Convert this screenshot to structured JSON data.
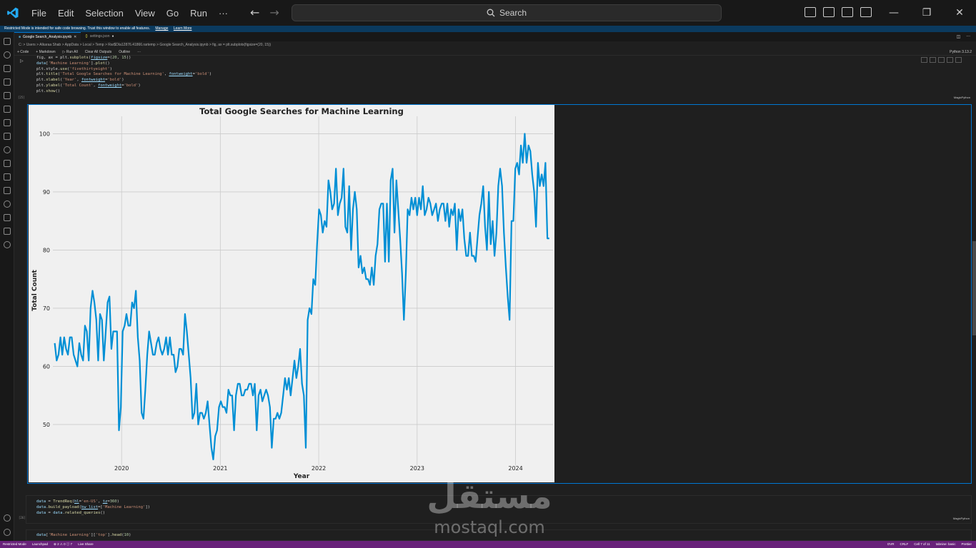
{
  "menu": [
    "File",
    "Edit",
    "Selection",
    "View",
    "Go",
    "Run",
    "···"
  ],
  "search_label": "Search",
  "restricted": {
    "text": "Restricted Mode is intended for safe code browsing. Trust this window to enable all features.",
    "manage": "Manage",
    "learn_more": "Learn More"
  },
  "tabs": [
    {
      "label": "Google Search_Analysis.ipynb",
      "active": true
    },
    {
      "label": "settings.json",
      "active": false
    }
  ],
  "breadcrumb": "C: > Users > Alkaraa Shab > AppData > Local > Temp > Rar$DIa12876.41866.rartemp > Google Search_Analysis.ipynb > fig, ax = plt.subplots(figsize=(20, 15))",
  "toolbar": {
    "code": "+ Code",
    "markdown": "+ Markdown",
    "run_all": "Run All",
    "clear_outputs": "Clear All Outputs",
    "outline": "Outline",
    "more": "···"
  },
  "kernel": "Python 3.13.2",
  "cell1": {
    "exec_count": "[25]",
    "lang": "MagicPython",
    "lines": [
      "fig, ax = plt.subplots(figsize=(20, 15))",
      "data['Machine Learning'].plot()",
      "plt.style.use('fivethirtyeight')",
      "plt.title('Total Google Searches for Machine Learning', fontweight='bold')",
      "plt.xlabel('Year', fontweight='bold')",
      "plt.ylabel('Total Count', fontweight='bold')",
      "plt.show()"
    ]
  },
  "cell2": {
    "exec_count": "[26]",
    "lang": "MagicPython",
    "lines": [
      "data = TrendReq(hl='en-US', tz=360)",
      "data.build_payload(kw_list=['Machine Learning'])",
      "data = data.related_queries()"
    ]
  },
  "cell3": {
    "lines": [
      "data['Machine Learning']['top'].head(10)"
    ]
  },
  "statusbar": {
    "left": [
      "Restricted Mode",
      "Launchpad",
      "⊗ 2 ⚠ 0 ⓘ 7",
      "Live Share"
    ],
    "right": [
      "OVR",
      "CRLF",
      "Cell 7 of 11",
      "tabnine: basic",
      "Prettier"
    ]
  },
  "watermark": {
    "ar": "مستقل",
    "en": "mostaql.com"
  },
  "colors": {
    "line": "#008fd5",
    "accent": "#0078d4",
    "status": "#68217a"
  },
  "chart_data": {
    "type": "line",
    "title": "Total Google Searches for Machine Learning",
    "xlabel": "Year",
    "ylabel": "Total Count",
    "x_ticks": [
      "2020",
      "2021",
      "2022",
      "2023",
      "2024"
    ],
    "y_ticks": [
      50,
      60,
      70,
      80,
      90,
      100
    ],
    "xlim": [
      "2019-04-21",
      "2024-05-19"
    ],
    "ylim": [
      43,
      103
    ],
    "grid": true,
    "series": [
      {
        "start": "2019-04-28",
        "interval_days": 7,
        "values": [
          64,
          61,
          62,
          65,
          62,
          65,
          63,
          62,
          65,
          65,
          62,
          61,
          60,
          64,
          62,
          61,
          67,
          66,
          61,
          70,
          73,
          71,
          68,
          61,
          69,
          68,
          61,
          66,
          71,
          72,
          63,
          66,
          66,
          66,
          49,
          53,
          66,
          67,
          69,
          67,
          67,
          71,
          70,
          73,
          65,
          61,
          52,
          51,
          56,
          62,
          66,
          64,
          62,
          62,
          64,
          65,
          63,
          62,
          63,
          65,
          62,
          65,
          62,
          62,
          59,
          60,
          63,
          63,
          62,
          69,
          66,
          62,
          58,
          51,
          52,
          57,
          50,
          52,
          52,
          51,
          52,
          54,
          50,
          46,
          44,
          48,
          49,
          53,
          54,
          53,
          53,
          52,
          56,
          55,
          55,
          49,
          55,
          57,
          57,
          55,
          55,
          56,
          56,
          57,
          57,
          55,
          57,
          49,
          55,
          56,
          54,
          55,
          56,
          55,
          53,
          46,
          51,
          51,
          52,
          51,
          52,
          55,
          58,
          56,
          58,
          55,
          58,
          61,
          58,
          60,
          63,
          57,
          55,
          46,
          68,
          70,
          69,
          75,
          74,
          81,
          87,
          86,
          83,
          85,
          84,
          92,
          90,
          87,
          88,
          94,
          86,
          88,
          89,
          94,
          84,
          83,
          91,
          80,
          87,
          90,
          87,
          77,
          79,
          76,
          77,
          75,
          75,
          74,
          77,
          74,
          79,
          81,
          87,
          88,
          88,
          78,
          88,
          78,
          92,
          94,
          83,
          92,
          87,
          82,
          76,
          68,
          76,
          87,
          86,
          89,
          87,
          89,
          86,
          89,
          87,
          91,
          86,
          87,
          89,
          88,
          86,
          87,
          88,
          85,
          87,
          88,
          88,
          85,
          88,
          84,
          87,
          86,
          88,
          80,
          87,
          85,
          87,
          82,
          79,
          79,
          83,
          79,
          79,
          78,
          82,
          86,
          88,
          91,
          84,
          80,
          90,
          81,
          85,
          79,
          83,
          91,
          94,
          91,
          83,
          77,
          72,
          68,
          85,
          85,
          94,
          95,
          93,
          98,
          95,
          100,
          95,
          98,
          97,
          93,
          90,
          84,
          95,
          91,
          93,
          91,
          95,
          82,
          82
        ]
      }
    ]
  }
}
